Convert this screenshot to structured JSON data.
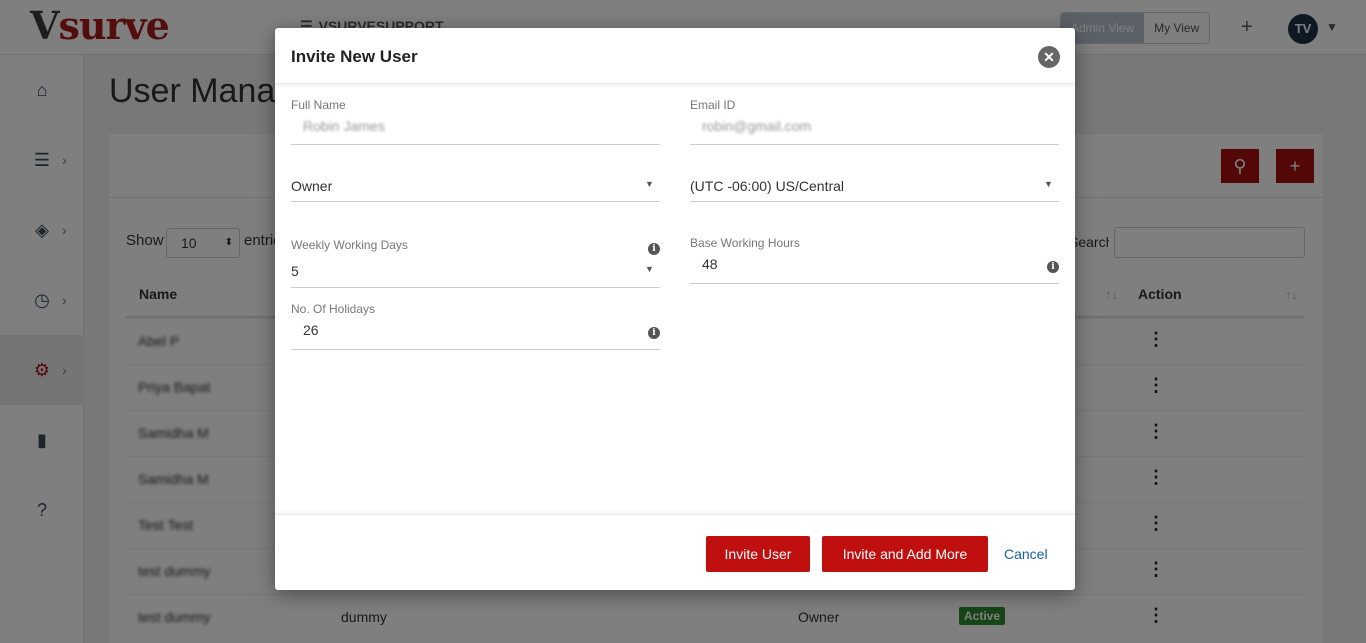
{
  "header": {
    "logo_v": "V",
    "logo_rest": "surve",
    "org_name": "VSURVESUPPORT",
    "admin_view": "Admin View",
    "my_view": "My View",
    "avatar_initials": "TV"
  },
  "page": {
    "title": "User Management"
  },
  "table": {
    "show_label": "Show",
    "show_value": "10",
    "entries_label": "entries",
    "search_label": "Search:",
    "columns": {
      "name": "Name",
      "action": "Action"
    },
    "rows": [
      {
        "name": "Abel P"
      },
      {
        "name": "Priya Bapat"
      },
      {
        "name": "Samidha M"
      },
      {
        "name": "Samidha M"
      },
      {
        "name": "Test Test"
      },
      {
        "name": "test dummy"
      },
      {
        "name": "test dummy",
        "last_name": "dummy",
        "role": "Owner",
        "status": "Active"
      }
    ]
  },
  "modal": {
    "title": "Invite New User",
    "full_name_label": "Full Name",
    "full_name_placeholder": "Robin James",
    "email_label": "Email ID",
    "email_placeholder": "robin@gmail.com",
    "role_value": "Owner",
    "timezone_value": "(UTC -06:00) US/Central",
    "weekly_days_label": "Weekly Working Days",
    "weekly_days_value": "5",
    "base_hours_label": "Base Working Hours",
    "base_hours_value": "48",
    "holidays_label": "No. Of Holidays",
    "holidays_value": "26",
    "invite_button": "Invite User",
    "invite_more_button": "Invite and Add More",
    "cancel_button": "Cancel"
  },
  "colors": {
    "brand_red": "#a80e0e",
    "button_red": "#c00f0f",
    "active_green": "#2c8a2c",
    "link_blue": "#1a5fa8"
  },
  "icons": [
    "home-icon",
    "server-icon",
    "ticket-icon",
    "clock-icon",
    "gear-icon",
    "file-icon",
    "help-icon",
    "search-icon",
    "plus-icon",
    "close-icon",
    "info-icon",
    "caret-down-icon",
    "sort-icon",
    "ellipsis-vertical-icon"
  ]
}
